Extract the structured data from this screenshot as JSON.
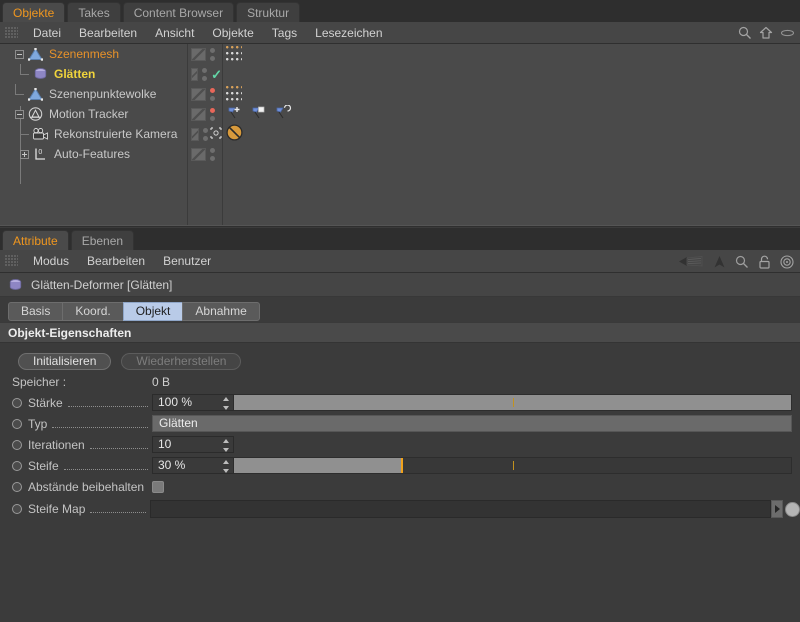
{
  "object_manager": {
    "tabs": [
      {
        "label": "Objekte",
        "active": true
      },
      {
        "label": "Takes",
        "active": false
      },
      {
        "label": "Content Browser",
        "active": false
      },
      {
        "label": "Struktur",
        "active": false
      }
    ],
    "menu": [
      "Datei",
      "Bearbeiten",
      "Ansicht",
      "Objekte",
      "Tags",
      "Lesezeichen"
    ],
    "right_icons": [
      "search-icon",
      "home-icon",
      "eye-icon"
    ],
    "tree": [
      {
        "name": "Szenenmesh",
        "color": "orange",
        "icon": "mesh-icon",
        "indent": 0,
        "expander": "minus",
        "tags_a": [
          "strip",
          "dots"
        ],
        "tags_b": [
          "dotgrid-orange"
        ]
      },
      {
        "name": "Glätten",
        "color": "yellow",
        "icon": "smooth-deformer-icon",
        "indent": 1,
        "expander": "none",
        "tags_a": [
          "strip",
          "dots-check"
        ],
        "tags_b": []
      },
      {
        "name": "Szenenpunktewolke",
        "color": "plain",
        "icon": "mesh-icon",
        "indent": 0,
        "expander": "none",
        "tags_a": [
          "strip",
          "dots-red"
        ],
        "tags_b": [
          "dotgrid-orange"
        ]
      },
      {
        "name": "Motion Tracker",
        "color": "plain",
        "icon": "motion-tracker-icon",
        "indent": 0,
        "expander": "minus",
        "tags_a": [
          "strip",
          "dots-red"
        ],
        "tags_b": [
          "pin-plus",
          "pin-square",
          "pin-loop"
        ]
      },
      {
        "name": "Rekonstruierte Kamera",
        "color": "plain",
        "icon": "camera-icon",
        "indent": 1,
        "expander": "none",
        "tags_a": [
          "strip",
          "dots-target"
        ],
        "tags_b": [
          "no-entry"
        ]
      },
      {
        "name": "Auto-Features",
        "color": "plain",
        "icon": "auto-features-icon",
        "indent": 0,
        "expander": "plus",
        "tags_a": [
          "strip",
          "dots"
        ],
        "tags_b": []
      }
    ]
  },
  "attribute_manager": {
    "tabs": [
      {
        "label": "Attribute",
        "active": true
      },
      {
        "label": "Ebenen",
        "active": false
      }
    ],
    "menu": [
      "Modus",
      "Bearbeiten",
      "Benutzer"
    ],
    "right_icons": [
      "back-arrow-icon",
      "forward-arrow-icon",
      "search-icon",
      "lock-icon",
      "target-icon"
    ],
    "object_title": "Glätten-Deformer [Glätten]",
    "subtabs": [
      {
        "label": "Basis",
        "active": false
      },
      {
        "label": "Koord.",
        "active": false
      },
      {
        "label": "Objekt",
        "active": true
      },
      {
        "label": "Abnahme",
        "active": false
      }
    ],
    "section_title": "Objekt-Eigenschaften",
    "buttons": {
      "initialize": "Initialisieren",
      "restore": "Wiederherstellen"
    },
    "memory": {
      "label": "Speicher :",
      "value": "0 B"
    },
    "properties": [
      {
        "label": "Stärke",
        "type": "number-slider",
        "value": "100 %",
        "slider_pct": 100
      },
      {
        "label": "Typ",
        "type": "dropdown",
        "value": "Glätten"
      },
      {
        "label": "Iterationen",
        "type": "number",
        "value": "10"
      },
      {
        "label": "Steife",
        "type": "number-slider",
        "value": "30 %",
        "slider_pct": 30
      },
      {
        "label": "Abstände beibehalten",
        "type": "checkbox",
        "value": ""
      },
      {
        "label": "Steife Map",
        "type": "map",
        "value": ""
      }
    ]
  },
  "colors": {
    "accent_orange": "#f0971f",
    "selected_yellow": "#f0d43c",
    "tab_active_blue": "#b9cbe8",
    "slider_handle": "#f0a21c",
    "panel_bg": "#3b3b3b"
  }
}
